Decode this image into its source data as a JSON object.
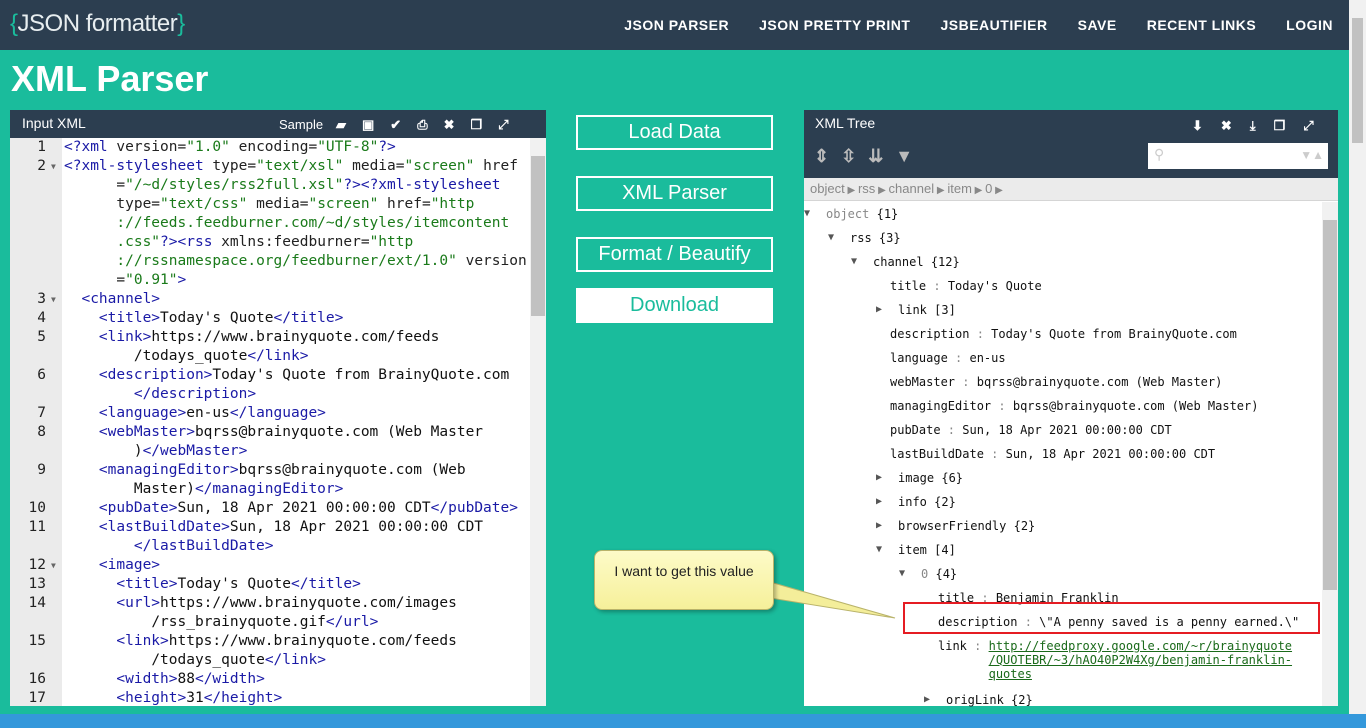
{
  "nav": {
    "logo_open": "{",
    "logo_text": "JSON formatter",
    "logo_close": "}",
    "links": [
      "JSON PARSER",
      "JSON PRETTY PRINT",
      "JSBEAUTIFIER",
      "SAVE",
      "RECENT LINKS",
      "LOGIN"
    ]
  },
  "page_title": "XML Parser",
  "input": {
    "title": "Input XML",
    "sample": "Sample",
    "icons": [
      "folder-open-icon",
      "save-icon",
      "check-icon",
      "print-icon",
      "close-icon",
      "copy-icon",
      "fullscreen-icon"
    ],
    "rows": [
      {
        "n": "1",
        "s": [
          [
            "tag",
            "<?xml"
          ],
          [
            "attr",
            " version="
          ],
          [
            "str",
            "\"1.0\""
          ],
          [
            "attr",
            " encoding="
          ],
          [
            "str",
            "\"UTF-8\""
          ],
          [
            "tag",
            "?>"
          ]
        ]
      },
      {
        "n": "2",
        "f": 1,
        "s": [
          [
            "tag",
            "<?xml-stylesheet"
          ],
          [
            "attr",
            " type="
          ],
          [
            "str",
            "\"text/xsl\""
          ],
          [
            "attr",
            " media="
          ],
          [
            "str",
            "\"screen\""
          ],
          [
            "attr",
            " href"
          ]
        ]
      },
      {
        "i": "      ",
        "s": [
          [
            "attr",
            "="
          ],
          [
            "str",
            "\"/~d/styles/rss2full.xsl\""
          ],
          [
            "tag",
            "?><?xml-stylesheet"
          ]
        ]
      },
      {
        "i": "      ",
        "s": [
          [
            "attr",
            "type="
          ],
          [
            "str",
            "\"text/css\""
          ],
          [
            "attr",
            " media="
          ],
          [
            "str",
            "\"screen\""
          ],
          [
            "attr",
            " href="
          ],
          [
            "str",
            "\"http"
          ]
        ]
      },
      {
        "i": "      ",
        "s": [
          [
            "str",
            "://feeds.feedburner.com/~d/styles/itemcontent"
          ]
        ]
      },
      {
        "i": "      ",
        "s": [
          [
            "str",
            ".css\""
          ],
          [
            "tag",
            "?><rss"
          ],
          [
            "attr",
            " xmlns:feedburner="
          ],
          [
            "str",
            "\"http"
          ]
        ]
      },
      {
        "i": "      ",
        "s": [
          [
            "str",
            "://rssnamespace.org/feedburner/ext/1.0\""
          ],
          [
            "attr",
            " version"
          ]
        ]
      },
      {
        "i": "      ",
        "s": [
          [
            "attr",
            "="
          ],
          [
            "str",
            "\"0.91\""
          ],
          [
            "tag",
            ">"
          ]
        ]
      },
      {
        "n": "3",
        "f": 1,
        "s": [
          [
            "tag",
            "  <channel>"
          ]
        ]
      },
      {
        "n": "4",
        "s": [
          [
            "tag",
            "    <title>"
          ],
          [
            "txt",
            "Today's Quote"
          ],
          [
            "tag",
            "</title>"
          ]
        ]
      },
      {
        "n": "5",
        "s": [
          [
            "tag",
            "    <link>"
          ],
          [
            "txt",
            "https://www.brainyquote.com/feeds"
          ]
        ]
      },
      {
        "i": "        ",
        "s": [
          [
            "txt",
            "/todays_quote"
          ],
          [
            "tag",
            "</link>"
          ]
        ]
      },
      {
        "n": "6",
        "s": [
          [
            "tag",
            "    <description>"
          ],
          [
            "txt",
            "Today's Quote from BrainyQuote.com"
          ]
        ]
      },
      {
        "i": "        ",
        "s": [
          [
            "tag",
            "</description>"
          ]
        ]
      },
      {
        "n": "7",
        "s": [
          [
            "tag",
            "    <language>"
          ],
          [
            "txt",
            "en-us"
          ],
          [
            "tag",
            "</language>"
          ]
        ]
      },
      {
        "n": "8",
        "s": [
          [
            "tag",
            "    <webMaster>"
          ],
          [
            "txt",
            "bqrss@brainyquote.com (Web Master"
          ]
        ]
      },
      {
        "i": "        ",
        "s": [
          [
            "txt",
            ")"
          ],
          [
            "tag",
            "</webMaster>"
          ]
        ]
      },
      {
        "n": "9",
        "s": [
          [
            "tag",
            "    <managingEditor>"
          ],
          [
            "txt",
            "bqrss@brainyquote.com (Web"
          ]
        ]
      },
      {
        "i": "        ",
        "s": [
          [
            "txt",
            "Master)"
          ],
          [
            "tag",
            "</managingEditor>"
          ]
        ]
      },
      {
        "n": "10",
        "s": [
          [
            "tag",
            "    <pubDate>"
          ],
          [
            "txt",
            "Sun, 18 Apr 2021 00:00:00 CDT"
          ],
          [
            "tag",
            "</pubDate>"
          ]
        ]
      },
      {
        "n": "11",
        "s": [
          [
            "tag",
            "    <lastBuildDate>"
          ],
          [
            "txt",
            "Sun, 18 Apr 2021 00:00:00 CDT"
          ]
        ]
      },
      {
        "i": "        ",
        "s": [
          [
            "tag",
            "</lastBuildDate>"
          ]
        ]
      },
      {
        "n": "12",
        "f": 1,
        "s": [
          [
            "tag",
            "    <image>"
          ]
        ]
      },
      {
        "n": "13",
        "s": [
          [
            "tag",
            "      <title>"
          ],
          [
            "txt",
            "Today's Quote"
          ],
          [
            "tag",
            "</title>"
          ]
        ]
      },
      {
        "n": "14",
        "s": [
          [
            "tag",
            "      <url>"
          ],
          [
            "txt",
            "https://www.brainyquote.com/images"
          ]
        ]
      },
      {
        "i": "          ",
        "s": [
          [
            "txt",
            "/rss_brainyquote.gif"
          ],
          [
            "tag",
            "</url>"
          ]
        ]
      },
      {
        "n": "15",
        "s": [
          [
            "tag",
            "      <link>"
          ],
          [
            "txt",
            "https://www.brainyquote.com/feeds"
          ]
        ]
      },
      {
        "i": "          ",
        "s": [
          [
            "txt",
            "/todays_quote"
          ],
          [
            "tag",
            "</link>"
          ]
        ]
      },
      {
        "n": "16",
        "s": [
          [
            "tag",
            "      <width>"
          ],
          [
            "txt",
            "88"
          ],
          [
            "tag",
            "</width>"
          ]
        ]
      },
      {
        "n": "17",
        "s": [
          [
            "tag",
            "      <height>"
          ],
          [
            "txt",
            "31"
          ],
          [
            "tag",
            "</height>"
          ]
        ]
      }
    ]
  },
  "buttons": {
    "load": "Load Data",
    "parse": "XML Parser",
    "format": "Format / Beautify",
    "download": "Download"
  },
  "tree": {
    "title": "XML Tree",
    "breadcrumb": [
      "object",
      "rss",
      "channel",
      "item",
      "0"
    ],
    "rows": [
      {
        "d": 0,
        "t": "open",
        "k": "object",
        "c": "{1}"
      },
      {
        "d": 1,
        "t": "open",
        "k": "rss",
        "c": " {3}"
      },
      {
        "d": 2,
        "t": "open",
        "k": "channel",
        "c": "{12}"
      },
      {
        "d": 3,
        "k": "title",
        "v": "Today's Quote"
      },
      {
        "d": 3,
        "t": "closed",
        "k": "link",
        "c": "[3]"
      },
      {
        "d": 3,
        "k": "description",
        "v": "Today's Quote from BrainyQuote.com"
      },
      {
        "d": 3,
        "k": "language",
        "v": "en-us"
      },
      {
        "d": 3,
        "k": "webMaster",
        "v": "bqrss@brainyquote.com (Web Master)"
      },
      {
        "d": 3,
        "k": "managingEditor",
        "v": "bqrss@brainyquote.com (Web Master)"
      },
      {
        "d": 3,
        "k": "pubDate",
        "v": "Sun, 18 Apr 2021 00:00:00 CDT"
      },
      {
        "d": 3,
        "k": "lastBuildDate",
        "v": "Sun, 18 Apr 2021 00:00:00 CDT"
      },
      {
        "d": 3,
        "t": "closed",
        "k": "image",
        "c": "{6}"
      },
      {
        "d": 3,
        "t": "closed",
        "k": "info",
        "c": "{2}"
      },
      {
        "d": 3,
        "t": "closed",
        "k": "browserFriendly",
        "c": "{2}"
      },
      {
        "d": 3,
        "t": "open",
        "k": "item",
        "c": "[4]"
      },
      {
        "d": 4,
        "t": "open",
        "k": "0",
        "c": "{4}"
      },
      {
        "d": 5,
        "k": "title",
        "v": "Benjamin Franklin"
      },
      {
        "d": 5,
        "k": "description",
        "v": "\\\"A penny saved is a penny earned.\\\""
      },
      {
        "d": 5,
        "k": "link",
        "link": [
          "http://feedproxy.google.com/~r/brainyquote",
          "/QUOTEBR/~3/hAO40P2W4Xg/benjamin-franklin-",
          "quotes"
        ]
      },
      {
        "d": 5,
        "t": "closed",
        "k": "origLink",
        "c": "{2}"
      }
    ]
  },
  "callout": {
    "text": "I want to get this value"
  },
  "colors": {
    "header": "#2c3e50",
    "accent": "#1abc9c",
    "highlight": "#e51c23"
  }
}
